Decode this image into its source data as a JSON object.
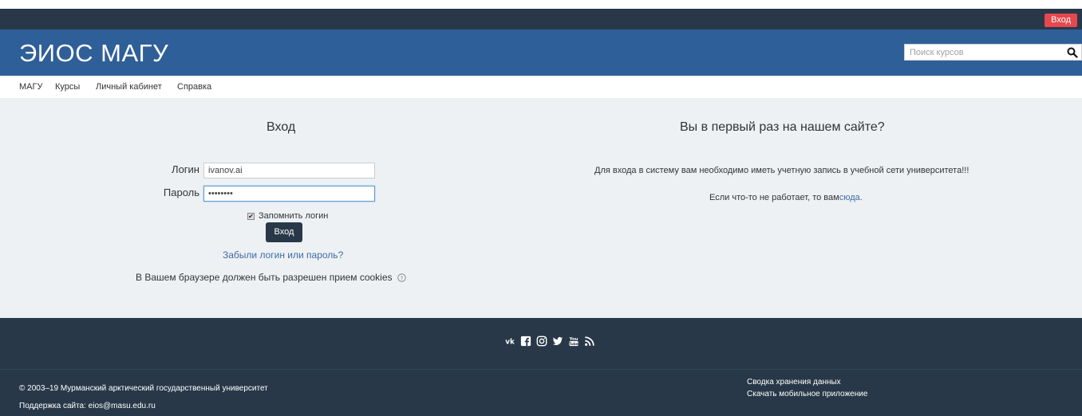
{
  "topbar": {
    "login_label": "Вход"
  },
  "header": {
    "title": "ЭИОС МАГУ",
    "search_placeholder": "Поиск курсов"
  },
  "nav": {
    "items": [
      "МАГУ",
      "Курсы",
      "Личный кабинет",
      "Справка"
    ]
  },
  "login": {
    "title": "Вход",
    "username_label": "Логин",
    "username_value": "ivanov.ai",
    "password_label": "Пароль",
    "password_value": "••••••••",
    "remember_label": "Запомнить логин",
    "remember_checked": true,
    "button_label": "Вход",
    "forgot_link": "Забыли логин или пароль?",
    "cookies_text": "В Вашем браузере должен быть разрешен прием cookies"
  },
  "first_time": {
    "title": "Вы в первый раз на нашем сайте?",
    "text1": "Для входа в систему вам необходимо иметь учетную запись в учебной сети университета!!!",
    "text2_prefix": "Если что-то не работает, то вам",
    "text2_link": "сюда."
  },
  "footer": {
    "social_icons": [
      "vk-icon",
      "facebook-icon",
      "instagram-icon",
      "twitter-icon",
      "youtube-icon",
      "rss-icon"
    ],
    "copyright": "© 2003–19 Мурманский арктический государственный университет",
    "support": "Поддержка сайта: eios@masu.edu.ru",
    "privacy_link": "Сводка хранения данных",
    "app_link": "Скачать мобильное приложение"
  },
  "colors": {
    "topbar": "#283849",
    "header": "#2f5f98",
    "login_button_top": "#e5484d",
    "link": "#3d6ba3",
    "main_bg": "#eef1f4"
  }
}
